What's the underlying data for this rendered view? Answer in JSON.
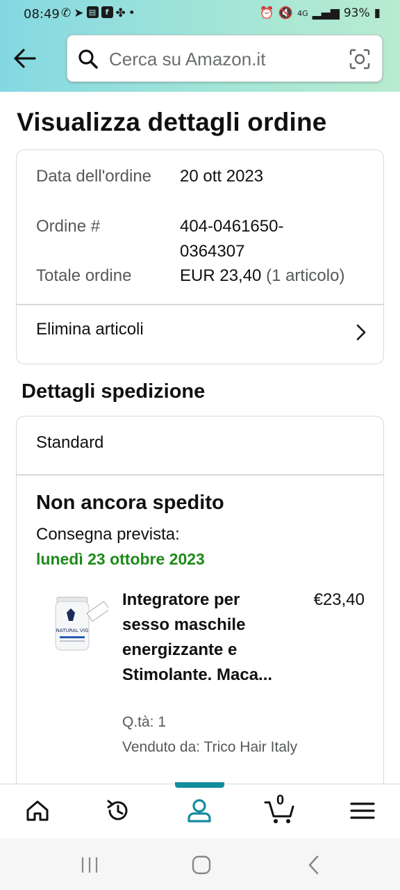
{
  "status_bar": {
    "time": "08:49",
    "battery": "93%",
    "network": "4G"
  },
  "search": {
    "placeholder": "Cerca su Amazon.it"
  },
  "page_title": "Visualizza dettagli ordine",
  "order_summary": {
    "date_label": "Data dell'ordine",
    "date_value": "20 ott 2023",
    "order_label": "Ordine #",
    "order_value_line1": "404-0461650-",
    "order_value_line2": "0364307",
    "total_label": "Totale ordine",
    "total_value": "EUR 23,40",
    "total_items": "(1 articolo)",
    "delete_items_label": "Elimina articoli"
  },
  "shipping": {
    "section_title": "Dettagli spedizione",
    "method": "Standard",
    "status": "Non ancora spedito",
    "delivery_label": "Consegna prevista:",
    "delivery_date": "lunedì 23 ottobre 2023",
    "item": {
      "title": "Integratore per sesso maschile energizzante e Stimolante. Maca...",
      "price": "€23,40",
      "quantity": "Q.tà: 1",
      "seller": "Venduto da: Trico Hair Italy",
      "image_label": "NATURAL VIG"
    }
  },
  "bottom_nav": {
    "cart_count": "0",
    "active": "account"
  },
  "colors": {
    "accent": "#138c9e",
    "green": "#1e8a1a"
  }
}
